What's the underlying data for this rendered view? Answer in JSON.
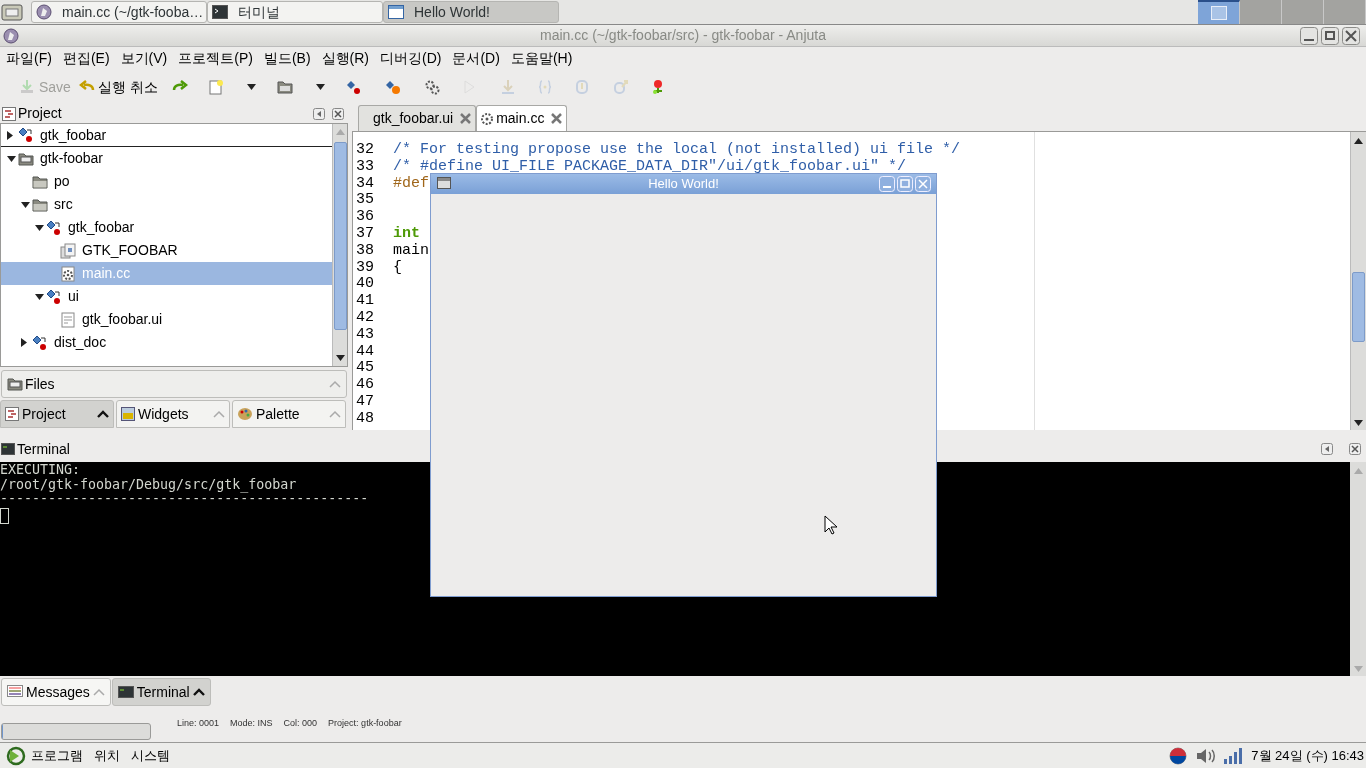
{
  "taskbar": {
    "tasks": [
      {
        "label": "main.cc (~/gtk-fooba…",
        "kind": "anjuta",
        "selected": false
      },
      {
        "label": "터미널",
        "kind": "terminal",
        "selected": false
      },
      {
        "label": "Hello World!",
        "kind": "window",
        "selected": true
      }
    ],
    "workspaces": [
      {
        "selected": true
      },
      {
        "selected": false
      },
      {
        "selected": false
      },
      {
        "selected": false
      }
    ]
  },
  "window": {
    "title": "main.cc (~/gtk-foobar/src) - gtk-foobar - Anjuta"
  },
  "menu": [
    "파일(F)",
    "편집(E)",
    "보기(V)",
    "프로젝트(P)",
    "빌드(B)",
    "실행(R)",
    "디버깅(D)",
    "문서(D)",
    "도움말(H)"
  ],
  "toolbar": [
    {
      "kind": "save",
      "label": "Save",
      "disabled": true
    },
    {
      "kind": "undo",
      "label": "실행 취소",
      "disabled": false
    },
    {
      "kind": "redo",
      "disabled": false
    },
    {
      "kind": "new",
      "disabled": false
    },
    {
      "kind": "caret",
      "disabled": false
    },
    {
      "kind": "open",
      "disabled": false
    },
    {
      "kind": "caret",
      "disabled": false
    },
    {
      "kind": "compile",
      "disabled": false
    },
    {
      "kind": "build",
      "disabled": false
    },
    {
      "kind": "gears",
      "disabled": false
    },
    {
      "kind": "run",
      "disabled": true
    },
    {
      "kind": "install",
      "disabled": true
    },
    {
      "kind": "braces",
      "disabled": true
    },
    {
      "kind": "step",
      "disabled": true
    },
    {
      "kind": "stepout",
      "disabled": true
    },
    {
      "kind": "debug",
      "disabled": false
    }
  ],
  "project_panel": {
    "title": "Project",
    "current_target": {
      "label": "gtk_foobar",
      "kind": "target",
      "expanded": false
    },
    "tree": [
      {
        "label": "gtk-foobar",
        "kind": "project",
        "expanded": true,
        "selected": false,
        "children": [
          {
            "label": "po",
            "kind": "folder",
            "selected": false
          },
          {
            "label": "src",
            "kind": "folder",
            "expanded": true,
            "selected": false,
            "children": [
              {
                "label": "gtk_foobar",
                "kind": "target",
                "expanded": true,
                "selected": false,
                "children": [
                  {
                    "label": "GTK_FOOBAR",
                    "kind": "group",
                    "selected": false
                  },
                  {
                    "label": "main.cc",
                    "kind": "source",
                    "selected": true
                  }
                ]
              },
              {
                "label": "ui",
                "kind": "target",
                "expanded": true,
                "selected": false,
                "children": [
                  {
                    "label": "gtk_foobar.ui",
                    "kind": "file",
                    "selected": false
                  }
                ]
              }
            ]
          },
          {
            "label": "dist_doc",
            "kind": "target",
            "expanded": false,
            "selected": false
          }
        ]
      }
    ],
    "files_bar": {
      "label": "Files"
    },
    "tabs": [
      {
        "label": "Project",
        "kind": "project",
        "selected": true
      },
      {
        "label": "Widgets",
        "kind": "widgets",
        "selected": false
      },
      {
        "label": "Palette",
        "kind": "palette",
        "selected": false
      }
    ]
  },
  "editor": {
    "tabs": [
      {
        "label": "gtk_foobar.ui",
        "selected": false
      },
      {
        "label": "main.cc",
        "selected": true
      }
    ],
    "lines": [
      {
        "number": "32",
        "kind": "comment",
        "text": "/* For testing propose use the local (not installed) ui file */"
      },
      {
        "number": "33",
        "kind": "comment",
        "text": "/* #define UI_FILE PACKAGE_DATA_DIR\"/ui/gtk_foobar.ui\" */"
      },
      {
        "number": "34",
        "kind": "preprocessor",
        "text": "#def"
      },
      {
        "number": "35"
      },
      {
        "number": "36"
      },
      {
        "number": "37",
        "kind": "keyword",
        "text": "int"
      },
      {
        "number": "38",
        "kind": "plain",
        "text": "main"
      },
      {
        "number": "39",
        "kind": "plain",
        "text": "{"
      },
      {
        "number": "40"
      },
      {
        "number": "41"
      },
      {
        "number": "42"
      },
      {
        "number": "43"
      },
      {
        "number": "44"
      },
      {
        "number": "45"
      },
      {
        "number": "46"
      },
      {
        "number": "47"
      },
      {
        "number": "48"
      }
    ]
  },
  "terminal_panel": {
    "title": "Terminal",
    "lines": [
      "EXECUTING:",
      "/root/gtk-foobar/Debug/src/gtk_foobar",
      "----------------------------------------------"
    ]
  },
  "bottom_tabs": [
    {
      "label": "Messages",
      "kind": "messages",
      "selected": false
    },
    {
      "label": "Terminal",
      "kind": "terminal",
      "selected": true
    }
  ],
  "status_bar": {
    "progress": {
      "level": 0
    },
    "fields": [
      "Line: 0001",
      "Mode: INS",
      "Col: 000",
      "Project: gtk-foobar"
    ]
  },
  "bottom_panel": {
    "menus": [
      "프로그램",
      "위치",
      "시스템"
    ],
    "clock": "7월 24일 (수) 16:43"
  },
  "dialog": {
    "title": "Hello World!"
  }
}
